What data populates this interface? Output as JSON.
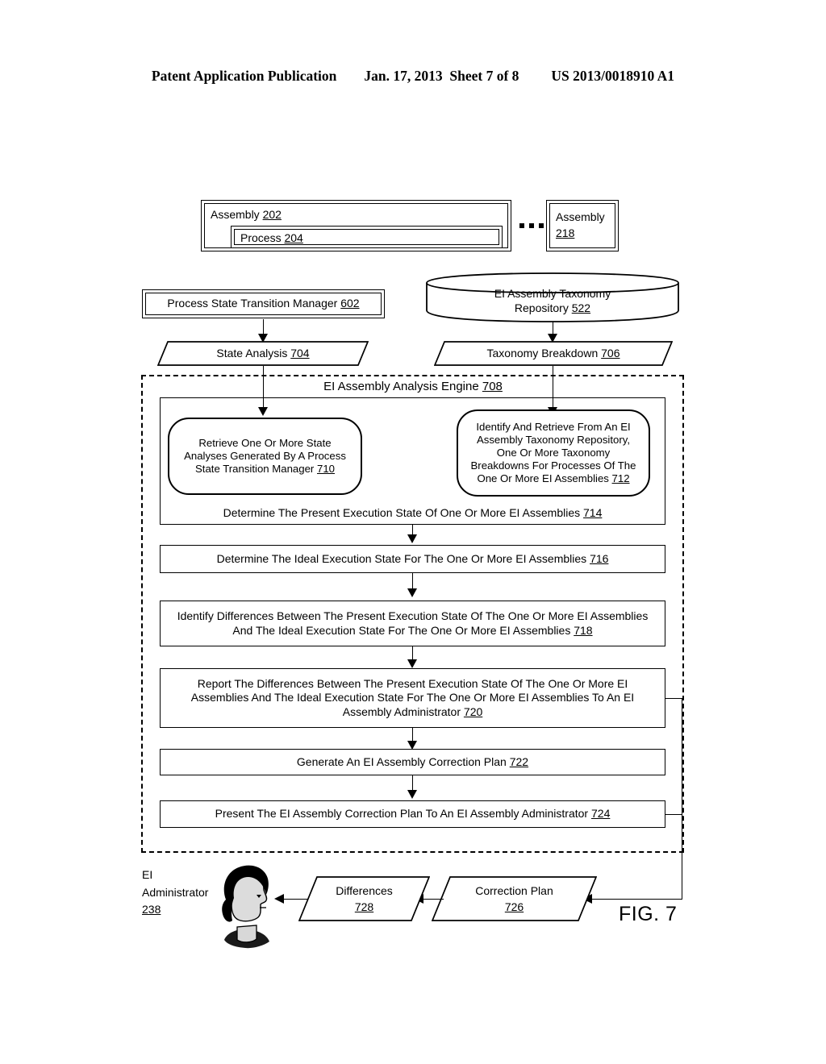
{
  "header": {
    "left": "Patent Application Publication",
    "date": "Jan. 17, 2013",
    "sheet": "Sheet 7 of 8",
    "number": "US 2013/0018910 A1"
  },
  "figure": {
    "label": "FIG. 7",
    "ellipsis": "..."
  },
  "assemblies": {
    "assembly_202": {
      "name": "Assembly",
      "ref": "202"
    },
    "process_204": {
      "name": "Process",
      "ref": "204"
    },
    "assembly_218": {
      "name": "Assembly",
      "ref": "218"
    }
  },
  "sources": {
    "manager_602": {
      "text": "Process State Transition Manager",
      "ref": "602"
    },
    "repository_522": {
      "line1": "EI Assembly Taxonomy",
      "line2": "Repository",
      "ref": "522"
    }
  },
  "data_flows": {
    "state_analysis_704": {
      "text": "State Analysis",
      "ref": "704"
    },
    "taxonomy_breakdown_706": {
      "text": "Taxonomy Breakdown",
      "ref": "706"
    },
    "differences_728": {
      "text": "Differences",
      "ref": "728"
    },
    "correction_plan_726": {
      "text": "Correction Plan",
      "ref": "726"
    }
  },
  "engine": {
    "title": "EI Assembly Analysis Engine",
    "ref": "708",
    "steps": [
      {
        "id": "710",
        "shape": "rounded",
        "text": "Retrieve One Or More State Analyses Generated By A Process State Transition Manager",
        "ref": "710"
      },
      {
        "id": "712",
        "shape": "rounded",
        "text": "Identify And Retrieve From An EI Assembly Taxonomy Repository, One Or More Taxonomy Breakdowns For Processes Of The One Or More EI Assemblies",
        "ref": "712"
      },
      {
        "id": "714",
        "shape": "rect",
        "text": "Determine The Present Execution State Of One Or More EI Assemblies",
        "ref": "714"
      },
      {
        "id": "716",
        "shape": "rect",
        "text": "Determine The Ideal Execution State For The One Or More EI Assemblies",
        "ref": "716"
      },
      {
        "id": "718",
        "shape": "rect",
        "text": "Identify Differences Between The Present Execution State Of The One Or More EI Assemblies And The Ideal Execution State For The One Or More EI Assemblies",
        "ref": "718"
      },
      {
        "id": "720",
        "shape": "rect",
        "text": "Report The Differences Between The Present Execution State Of The One Or More EI Assemblies And The Ideal Execution State For The One Or More EI Assemblies To An EI Assembly Administrator",
        "ref": "720"
      },
      {
        "id": "722",
        "shape": "rect",
        "text": "Generate An EI Assembly Correction Plan",
        "ref": "722"
      },
      {
        "id": "724",
        "shape": "rect",
        "text": "Present The EI Assembly Correction Plan To An EI Assembly Administrator",
        "ref": "724"
      }
    ]
  },
  "actor": {
    "line1": "EI",
    "line2": "Administrator",
    "ref": "238",
    "icon": "administrator-head-icon"
  }
}
